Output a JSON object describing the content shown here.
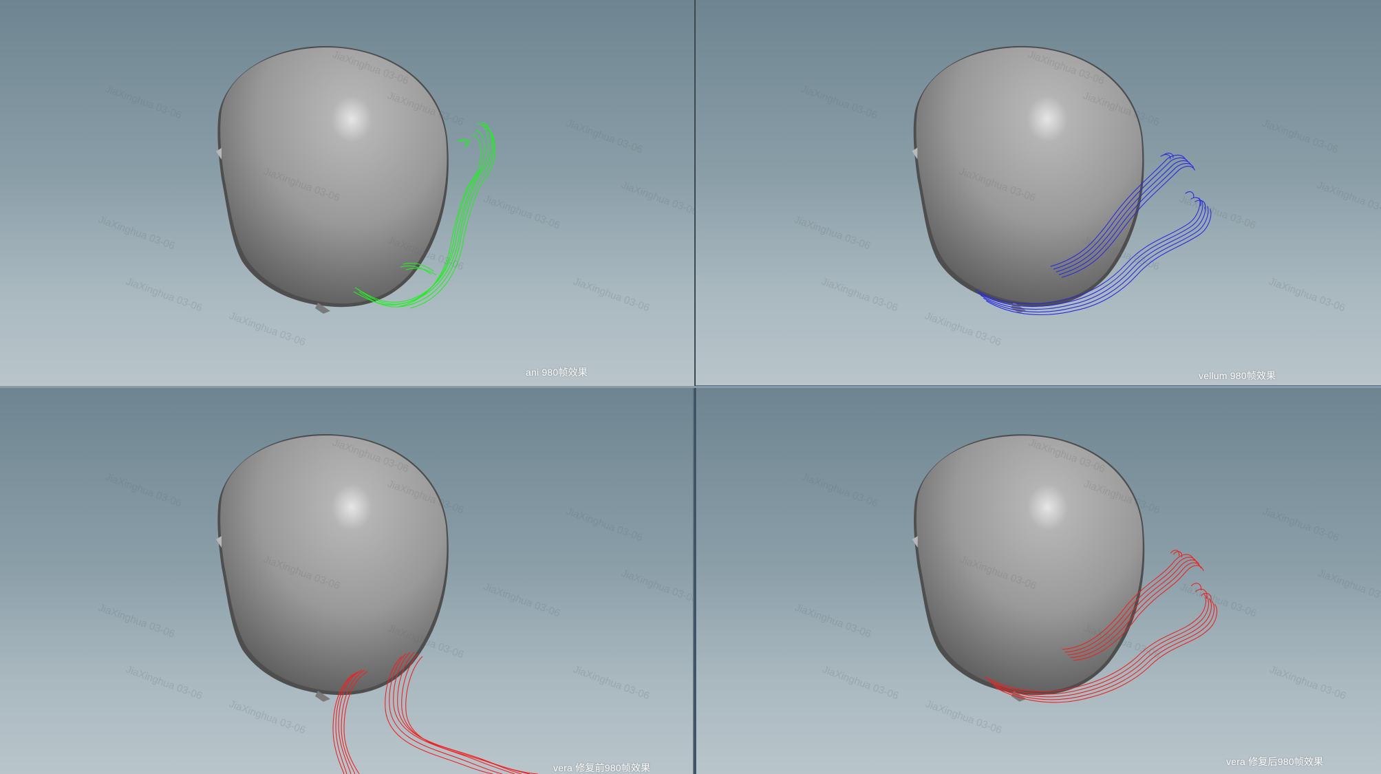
{
  "viewports": [
    {
      "caption": "ani 980帧效果",
      "curve_color": "#22ee22"
    },
    {
      "caption": "vellum 980帧效果",
      "curve_color": "#2a2ae0"
    },
    {
      "caption": "vera 修复前980帧效果",
      "curve_color": "#ee2222"
    },
    {
      "caption": "vera 修复后980帧效果",
      "curve_color": "#ee2222"
    }
  ],
  "watermark": "JiaXinghua 03-06",
  "colors": {
    "background_top": "#6e8591",
    "background_bottom": "#b9c5cb",
    "head": "#9b9b9b"
  }
}
